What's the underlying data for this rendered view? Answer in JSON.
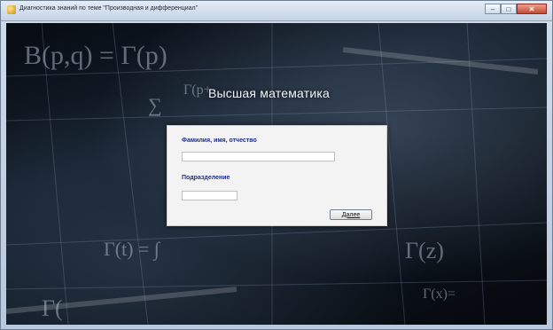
{
  "window": {
    "title": "Диагностика знаний по теме \"Производная и дифференциал\""
  },
  "controls": {
    "minimize_icon": "minimize-icon",
    "maximize_icon": "maximize-icon",
    "close_icon": "close-icon",
    "minimize_glyph": "–",
    "maximize_glyph": "□",
    "close_glyph": "✕"
  },
  "main": {
    "heading": "Высшая математика",
    "form": {
      "fio_label": "Фамилия, имя, отчество",
      "fio_value": "",
      "department_label": "Подразделение",
      "department_value": "",
      "next_button": "Далее"
    }
  },
  "background": {
    "formula_1": "B(p,q) = Γ(p)",
    "formula_2": "Γ(p+",
    "formula_3": "Γ(t) = ∫",
    "formula_4": "Γ(z)",
    "formula_5": "Γ(",
    "formula_6": "∑",
    "formula_7": "Γ(x)="
  },
  "colors": {
    "label_text": "#1e2d8f",
    "panel_bg": "#f3f3f3",
    "close_button": "#c44a32"
  }
}
